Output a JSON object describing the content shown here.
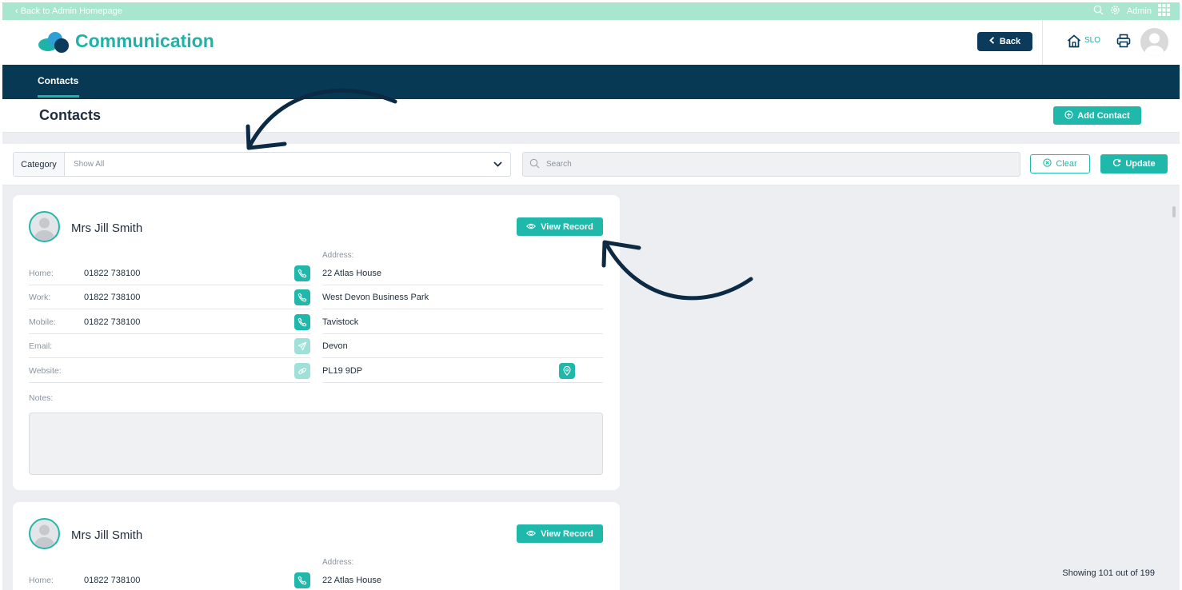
{
  "topbar": {
    "back_link": "‹ Back to Admin Homepage",
    "admin_label": "Admin"
  },
  "header": {
    "app_title": "Communication",
    "back_label": "Back",
    "site_code": "SLO"
  },
  "nav": {
    "tabs": [
      {
        "label": "Contacts",
        "active": true
      }
    ]
  },
  "page": {
    "title": "Contacts",
    "add_contact_label": "Add Contact"
  },
  "filters": {
    "category_label": "Category",
    "category_value": "Show All",
    "search_placeholder": "Search",
    "clear_label": "Clear",
    "update_label": "Update"
  },
  "contacts": [
    {
      "name": "Mrs Jill Smith",
      "view_label": "View Record",
      "fields": [
        {
          "label": "Home:",
          "value": "01822 738100",
          "icon": "phone-icon",
          "active": true
        },
        {
          "label": "Work:",
          "value": "01822 738100",
          "icon": "phone-icon",
          "active": true
        },
        {
          "label": "Mobile:",
          "value": "01822 738100",
          "icon": "phone-icon",
          "active": true
        },
        {
          "label": "Email:",
          "value": "",
          "icon": "send-icon",
          "active": false
        },
        {
          "label": "Website:",
          "value": "",
          "icon": "link-icon",
          "active": false
        }
      ],
      "address_label": "Address:",
      "address": [
        "22 Atlas House",
        "West Devon Business Park",
        "Tavistock",
        "Devon",
        "PL19 9DP"
      ],
      "notes_label": "Notes:"
    },
    {
      "name": "Mrs Jill Smith",
      "view_label": "View Record",
      "fields": [
        {
          "label": "Home:",
          "value": "01822 738100",
          "icon": "phone-icon",
          "active": true
        }
      ],
      "address_label": "Address:",
      "address": [
        "22 Atlas House"
      ]
    }
  ],
  "footer": {
    "showing_text": "Showing 101 out of 199"
  },
  "colors": {
    "accent": "#20b8aa",
    "navy": "#073854",
    "topbar": "#a8e6d0",
    "annotation_arrow": "#0d2a44"
  }
}
